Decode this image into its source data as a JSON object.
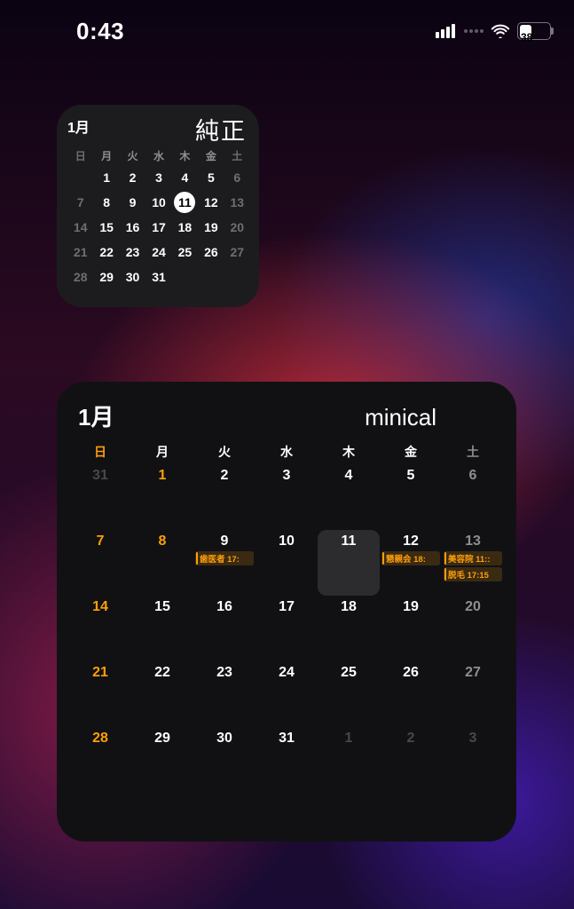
{
  "status": {
    "time": "0:43",
    "battery_pct": "38"
  },
  "widget_small": {
    "month": "1月",
    "title": "純正",
    "dow": [
      "日",
      "月",
      "火",
      "水",
      "木",
      "金",
      "土"
    ],
    "days": [
      {
        "n": "",
        "dim": true
      },
      {
        "n": "1"
      },
      {
        "n": "2"
      },
      {
        "n": "3"
      },
      {
        "n": "4"
      },
      {
        "n": "5"
      },
      {
        "n": "6",
        "dim": true
      },
      {
        "n": "7",
        "dim": true
      },
      {
        "n": "8"
      },
      {
        "n": "9"
      },
      {
        "n": "10"
      },
      {
        "n": "11",
        "today": true
      },
      {
        "n": "12"
      },
      {
        "n": "13",
        "dim": true
      },
      {
        "n": "14",
        "dim": true
      },
      {
        "n": "15"
      },
      {
        "n": "16"
      },
      {
        "n": "17"
      },
      {
        "n": "18"
      },
      {
        "n": "19"
      },
      {
        "n": "20",
        "dim": true
      },
      {
        "n": "21",
        "dim": true
      },
      {
        "n": "22"
      },
      {
        "n": "23"
      },
      {
        "n": "24"
      },
      {
        "n": "25"
      },
      {
        "n": "26"
      },
      {
        "n": "27",
        "dim": true
      },
      {
        "n": "28",
        "dim": true
      },
      {
        "n": "29"
      },
      {
        "n": "30"
      },
      {
        "n": "31"
      },
      {
        "n": ""
      },
      {
        "n": ""
      },
      {
        "n": ""
      }
    ]
  },
  "widget_large": {
    "month": "1月",
    "title": "minical",
    "dow": [
      "日",
      "月",
      "火",
      "水",
      "木",
      "金",
      "土"
    ],
    "days": [
      {
        "n": "31",
        "dim": true
      },
      {
        "n": "1",
        "sun": true
      },
      {
        "n": "2"
      },
      {
        "n": "3"
      },
      {
        "n": "4"
      },
      {
        "n": "5"
      },
      {
        "n": "6",
        "sat": true
      },
      {
        "n": "7",
        "sun": true
      },
      {
        "n": "8",
        "sun": true
      },
      {
        "n": "9",
        "events": [
          "歯医者 17:"
        ]
      },
      {
        "n": "10"
      },
      {
        "n": "11",
        "today": true
      },
      {
        "n": "12",
        "events": [
          "懇親会 18:"
        ]
      },
      {
        "n": "13",
        "sat": true,
        "events": [
          "美容院 11::",
          "脱毛 17:15"
        ]
      },
      {
        "n": "14",
        "sun": true
      },
      {
        "n": "15"
      },
      {
        "n": "16"
      },
      {
        "n": "17"
      },
      {
        "n": "18"
      },
      {
        "n": "19"
      },
      {
        "n": "20",
        "sat": true
      },
      {
        "n": "21",
        "sun": true
      },
      {
        "n": "22"
      },
      {
        "n": "23"
      },
      {
        "n": "24"
      },
      {
        "n": "25"
      },
      {
        "n": "26"
      },
      {
        "n": "27",
        "sat": true
      },
      {
        "n": "28",
        "sun": true
      },
      {
        "n": "29"
      },
      {
        "n": "30"
      },
      {
        "n": "31"
      },
      {
        "n": "1",
        "dim": true
      },
      {
        "n": "2",
        "dim": true
      },
      {
        "n": "3",
        "dim": true
      }
    ]
  }
}
